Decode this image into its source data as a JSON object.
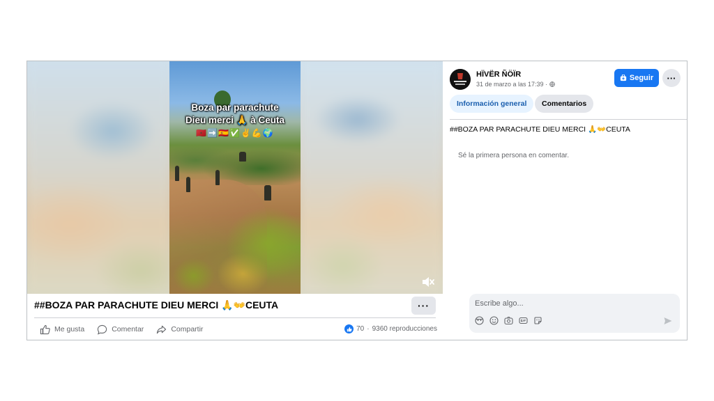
{
  "video": {
    "caption_line1": "Boza par parachute",
    "caption_line2": "Dieu merci 🙏 à Ceuta",
    "caption_emojis": "🇲🇦➡️🇪🇸✅✌️💪🌍"
  },
  "post": {
    "title": "##BOZA PAR PARACHUTE DIEU MERCI 🙏👐CEUTA",
    "more_label": "···",
    "actions": {
      "like": "Me gusta",
      "comment": "Comentar",
      "share": "Compartir"
    },
    "stats": {
      "reactions": "70",
      "separator": "·",
      "views": "9360 reproducciones"
    }
  },
  "sidebar": {
    "author": "HÏVËR ÑÖÏR",
    "date": "31 de marzo a las 17:39 ·",
    "follow_label": "Seguir",
    "more_label": "···",
    "tabs": {
      "info": "Información general",
      "comments": "Comentarios"
    },
    "description": "##BOZA PAR PARACHUTE DIEU MERCI 🙏👐CEUTA",
    "empty_comments": "Sé la primera persona en comentar.",
    "composer_placeholder": "Escribe algo..."
  },
  "colors": {
    "accent": "#1877f2",
    "muted_text": "#65676b",
    "button_bg": "#e4e6eb",
    "tab_active_bg": "#e7f3ff"
  },
  "icons": {
    "like": "thumbs-up-icon",
    "comment": "comment-bubble-icon",
    "share": "share-arrow-icon",
    "mute": "speaker-muted-icon",
    "globe": "globe-icon",
    "follow": "follow-plus-icon",
    "send": "send-icon"
  }
}
